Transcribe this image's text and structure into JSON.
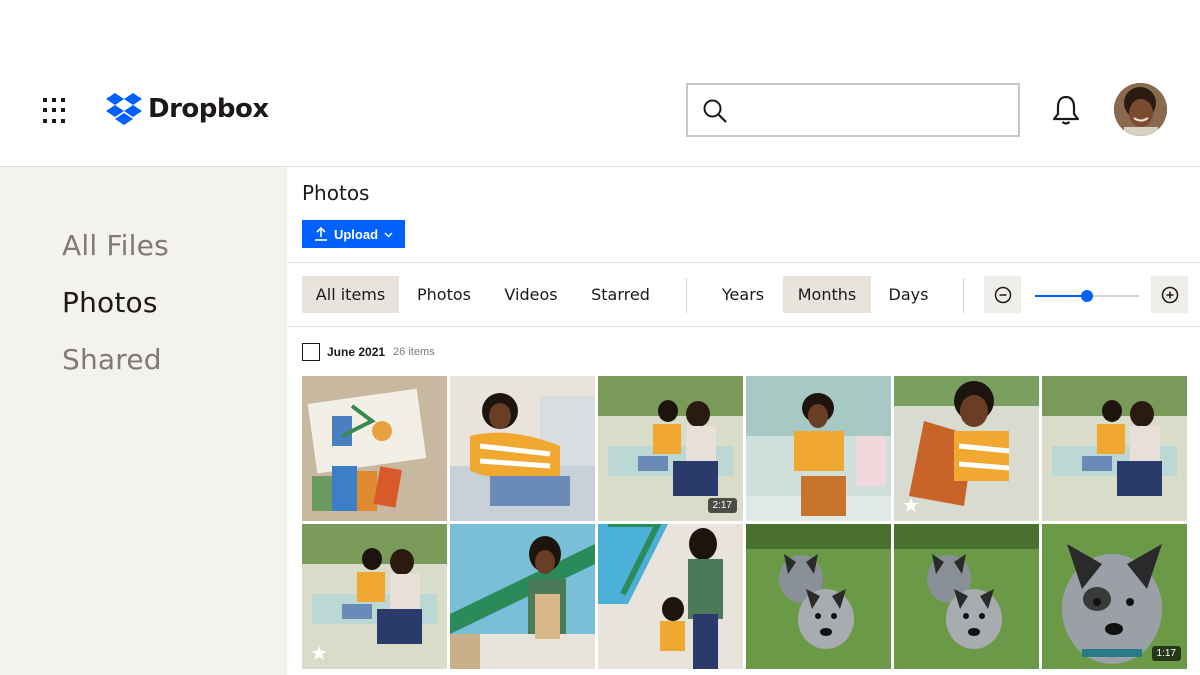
{
  "header": {
    "brand": "Dropbox",
    "search": {
      "value": "",
      "placeholder": ""
    }
  },
  "sidebar": {
    "items": [
      {
        "label": "All Files",
        "active": false
      },
      {
        "label": "Photos",
        "active": true
      },
      {
        "label": "Shared",
        "active": false
      }
    ]
  },
  "main": {
    "title": "Photos",
    "upload_label": "Upload",
    "filters": [
      "All items",
      "Photos",
      "Videos",
      "Starred"
    ],
    "active_filter": "All items",
    "scales": [
      "Years",
      "Months",
      "Days"
    ],
    "active_scale": "Months",
    "zoom_level": 0.5,
    "group": {
      "title": "June 2021",
      "count": "26 items"
    },
    "thumbnails": [
      {
        "subject": "artwork",
        "duration": "",
        "starred": false
      },
      {
        "subject": "boy on swing",
        "duration": "",
        "starred": false
      },
      {
        "subject": "mother and son on swing",
        "duration": "2:17",
        "starred": false
      },
      {
        "subject": "boy holding pillow",
        "duration": "",
        "starred": false
      },
      {
        "subject": "boy smiling",
        "duration": "",
        "starred": true
      },
      {
        "subject": "mother and son on swing",
        "duration": "",
        "starred": false
      },
      {
        "subject": "mother and son on swing",
        "duration": "",
        "starred": true
      },
      {
        "subject": "woman painting",
        "duration": "",
        "starred": false
      },
      {
        "subject": "mother and child painting",
        "duration": "",
        "starred": false
      },
      {
        "subject": "two dogs",
        "duration": "",
        "starred": false
      },
      {
        "subject": "two dogs",
        "duration": "",
        "starred": false
      },
      {
        "subject": "dog close-up",
        "duration": "1:17",
        "starred": false
      }
    ]
  },
  "colors": {
    "accent": "#0061fe",
    "sidebar_bg": "#f4f2ef",
    "active_chip": "#e8e3dd"
  }
}
